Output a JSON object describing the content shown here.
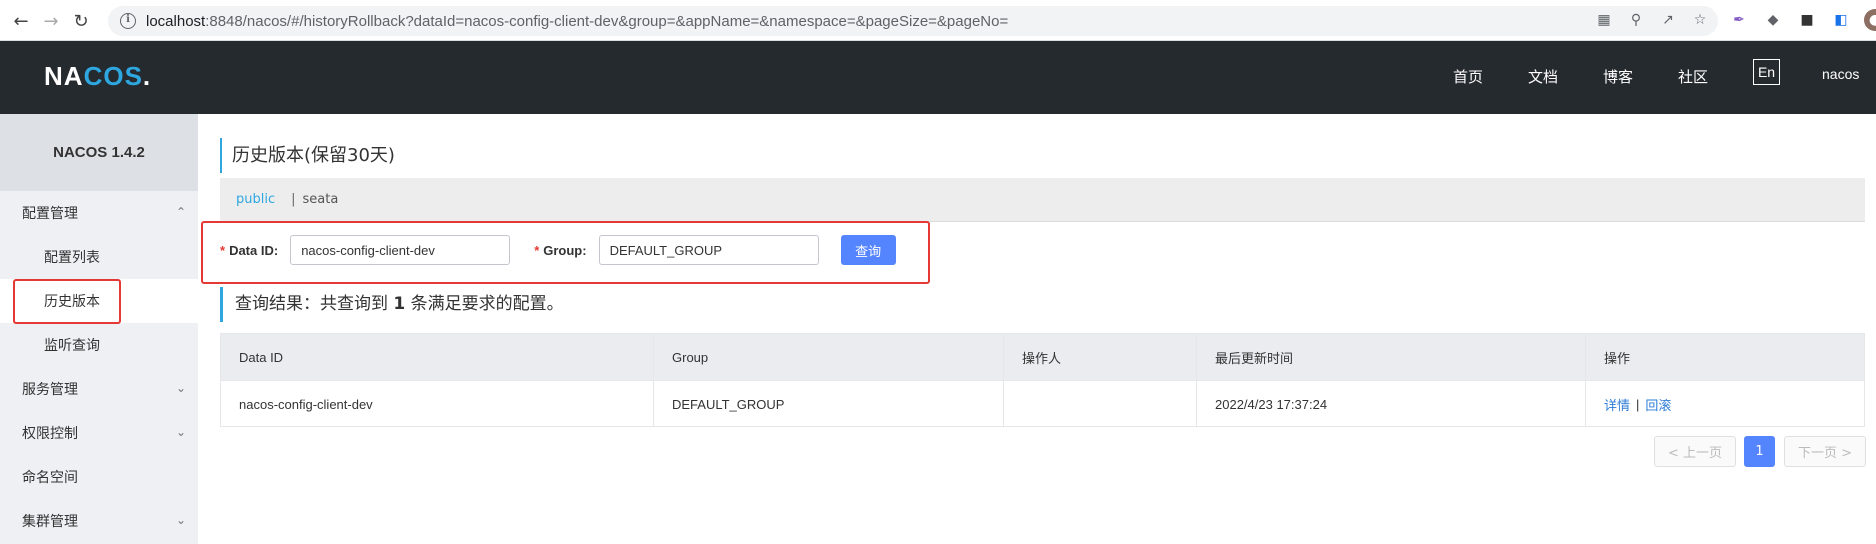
{
  "browser": {
    "url_host": "localhost",
    "url_rest": ":8848/nacos/#/historyRollback?dataId=nacos-config-client-dev&group=&appName=&namespace=&pageSize=&pageNo="
  },
  "header": {
    "logo_left": "NA",
    "logo_mid": "COS",
    "logo_right": ".",
    "nav": [
      "首页",
      "文档",
      "博客",
      "社区"
    ],
    "lang": "En",
    "user": "nacos"
  },
  "sidebar": {
    "version": "NACOS 1.4.2",
    "items": [
      {
        "label": "配置管理"
      },
      {
        "label": "配置列表"
      },
      {
        "label": "历史版本"
      },
      {
        "label": "监听查询"
      },
      {
        "label": "服务管理"
      },
      {
        "label": "权限控制"
      },
      {
        "label": "命名空间"
      },
      {
        "label": "集群管理"
      }
    ]
  },
  "main": {
    "title": "历史版本(保留30天)",
    "namespaces": [
      "public",
      "|",
      "seata"
    ],
    "search": {
      "dataid_label": "Data ID:",
      "dataid_value": "nacos-config-client-dev",
      "group_label": "Group:",
      "group_value": "DEFAULT_GROUP",
      "required_mark": "*",
      "query_button": "查询"
    },
    "result": {
      "prefix": "查询结果：共查询到 ",
      "count": "1",
      "suffix": " 条满足要求的配置。"
    },
    "table": {
      "columns": [
        "Data ID",
        "Group",
        "操作人",
        "最后更新时间",
        "操作"
      ],
      "rows": [
        {
          "data_id": "nacos-config-client-dev",
          "group": "DEFAULT_GROUP",
          "operator": "",
          "updated": "2022/4/23 17:37:24",
          "detail": "详情",
          "sep": "|",
          "rollback": "回滚"
        }
      ]
    },
    "pagination": {
      "prev": "< 上一页",
      "current": "1",
      "next": "下一页 >"
    }
  },
  "colors": {
    "accent": "#2ea7e0",
    "primary_button": "#5584ff",
    "highlight_box": "#e53935",
    "header_bg": "#252a2f"
  }
}
